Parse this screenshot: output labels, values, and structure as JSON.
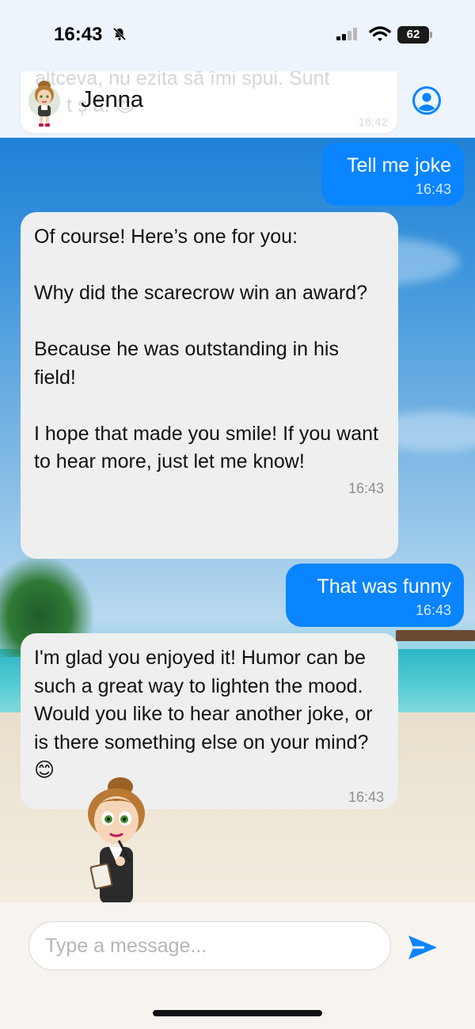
{
  "status_bar": {
    "time": "16:43",
    "battery": "62",
    "icons": [
      "bell-slash-icon",
      "signal-icon",
      "wifi-icon",
      "battery-icon"
    ]
  },
  "header": {
    "ghost_text_line1": "altceva, nu ezita să îmi spui. Sunt",
    "ghost_text_line2": "t    ș   ă!  😊",
    "ghost_time": "16:42",
    "contact_name": "Jenna",
    "icons": [
      "avatar",
      "profile-icon"
    ]
  },
  "messages": [
    {
      "direction": "out",
      "text": "Tell me joke",
      "time": "16:43"
    },
    {
      "direction": "in",
      "text": "Of course! Here’s one for you:\n\nWhy did the scarecrow win an award?\n\nBecause he was outstanding in his field!\n\nI hope that made you smile! If you want to hear more, just let me know!",
      "time": "16:43"
    },
    {
      "direction": "out",
      "text": "That was funny",
      "time": "16:43"
    },
    {
      "direction": "in",
      "text": "I'm glad you enjoyed it! Humor can be such a great way to lighten the mood. Would you like to hear another joke, or is there something else on your mind? 😊",
      "time": "16:43"
    }
  ],
  "input": {
    "placeholder": "Type a message...",
    "value": ""
  },
  "colors": {
    "accent": "#0a84ff",
    "incoming_bubble": "#efefef",
    "header_bg": "#eef4fb"
  }
}
